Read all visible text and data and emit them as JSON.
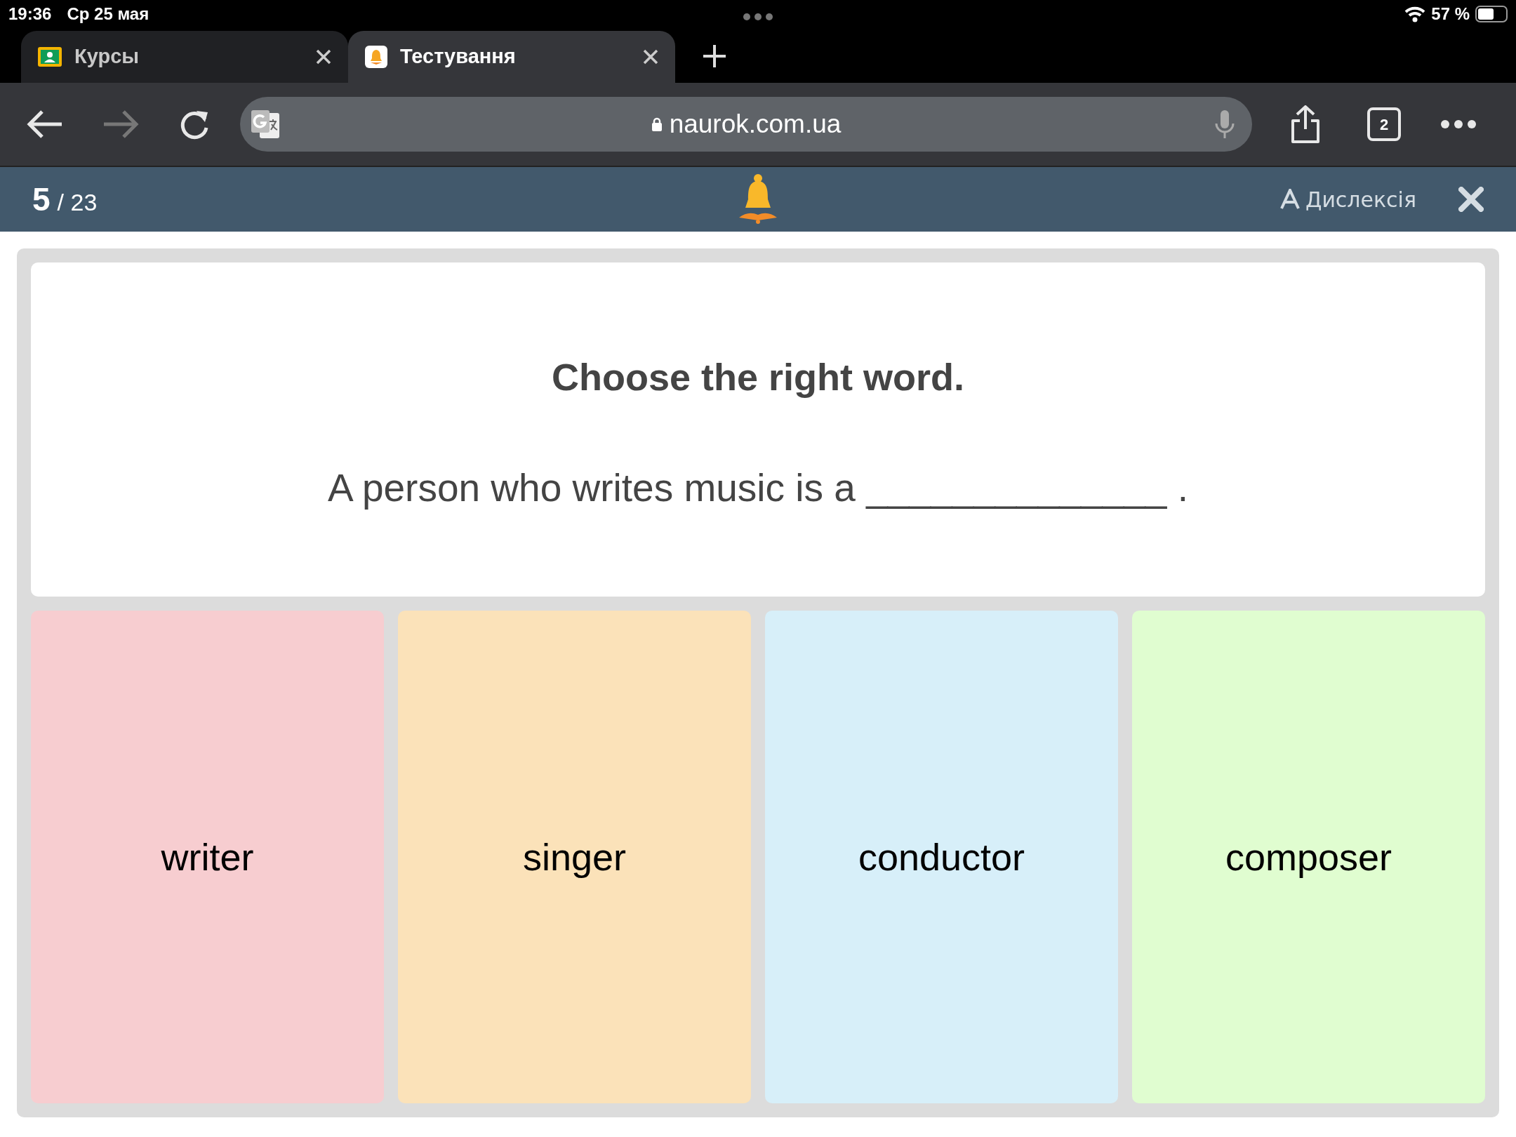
{
  "status_bar": {
    "time": "19:36",
    "date": "Ср 25 мая",
    "battery": "57 %"
  },
  "tabs": [
    {
      "title": "Курсы",
      "kind": "classroom",
      "selected": false
    },
    {
      "title": "Тестування",
      "kind": "quiz",
      "selected": true
    }
  ],
  "address_bar": {
    "url": "naurok.com.ua"
  },
  "tab_count": "2",
  "quiz_header": {
    "current": "5",
    "total": "/ 23",
    "dyslexia": "Дислексія"
  },
  "question": {
    "title": "Choose the right word.",
    "text": "A person who writes music is a ______________ ."
  },
  "answers": [
    {
      "label": "writer",
      "color": "#f7cdd0"
    },
    {
      "label": "singer",
      "color": "#fbe2b9"
    },
    {
      "label": "conductor",
      "color": "#d7eff9"
    },
    {
      "label": "composer",
      "color": "#e0fdd0"
    }
  ]
}
